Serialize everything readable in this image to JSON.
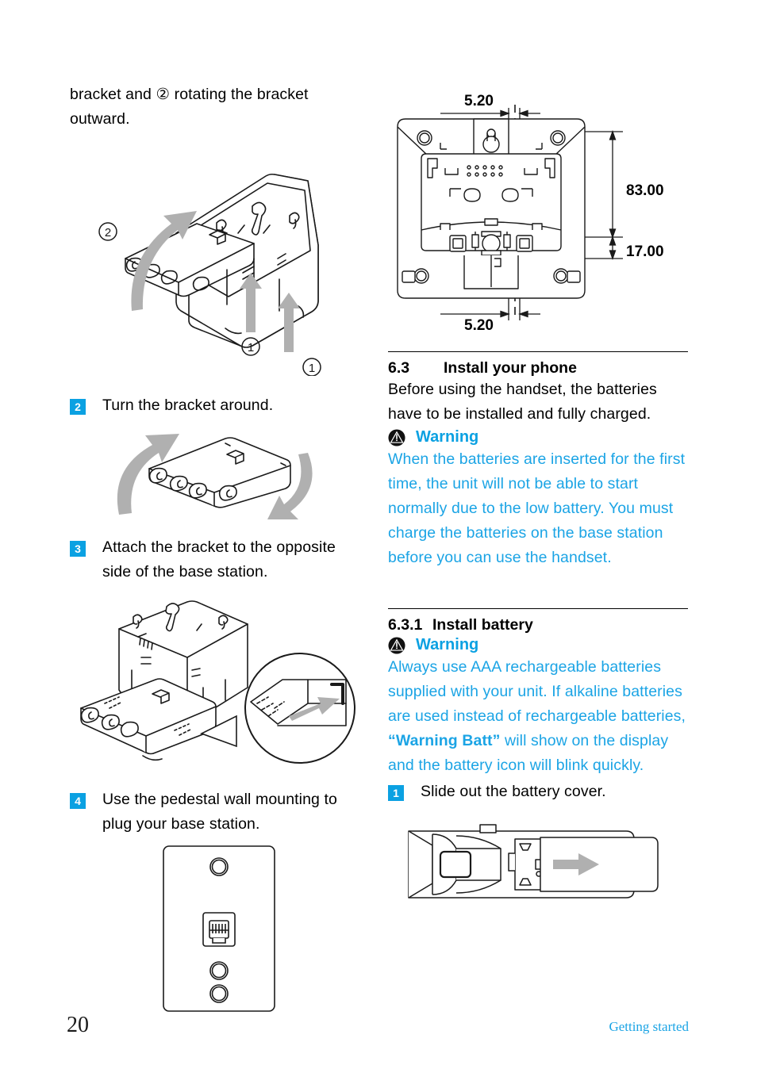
{
  "page": {
    "number": "20",
    "section_footer": "Getting started",
    "accent_color": "#0BA1E2",
    "body_text_color": "#000000",
    "warning_text_color": "#1BA4E5"
  },
  "left_column": {
    "continued_paragraph": "bracket and ② rotating the bracket outward.",
    "figure_1": {
      "name": "base-station-bracket-removal-diagram",
      "callouts": [
        "②",
        "①",
        "①"
      ]
    },
    "steps": [
      {
        "number": "2",
        "text": "Turn the bracket around.",
        "figure": "bracket-rotation-diagram"
      },
      {
        "number": "3",
        "text": "Attach the bracket to the opposite side of the base station.",
        "figure": "bracket-attach-diagram"
      },
      {
        "number": "4",
        "text": "Use the pedestal wall mounting to plug your base station.",
        "figure": "wall-plate-diagram"
      }
    ]
  },
  "right_column": {
    "dimension_drawing": {
      "name": "base-station-rear-dimensions",
      "labels": {
        "top": "5.20",
        "bottom": "5.20",
        "right_upper": "83.00",
        "right_lower": "17.00"
      }
    },
    "section_6_3": {
      "number": "6.3",
      "title": "Install your phone",
      "intro": "Before using the handset, the batteries have to be installed and fully charged.",
      "warning_label": "Warning",
      "warning_text": "When the batteries are inserted for the first time, the unit will not be able to start normally due to the low battery. You must charge the batteries on the base station before you can use the handset."
    },
    "section_6_3_1": {
      "number": "6.3.1",
      "title": "Install battery",
      "warning_label": "Warning",
      "warning_text_part1": "Always use AAA rechargeable batteries supplied with your unit. If alkaline batteries are used instead of rechargeable batteries, ",
      "warning_emphasis": "“Warning Batt”",
      "warning_text_part2": " will show on the display and the battery icon will blink quickly.",
      "step": {
        "number": "1",
        "text": "Slide out the battery cover."
      },
      "figure": "handset-battery-cover-slide-diagram"
    }
  }
}
